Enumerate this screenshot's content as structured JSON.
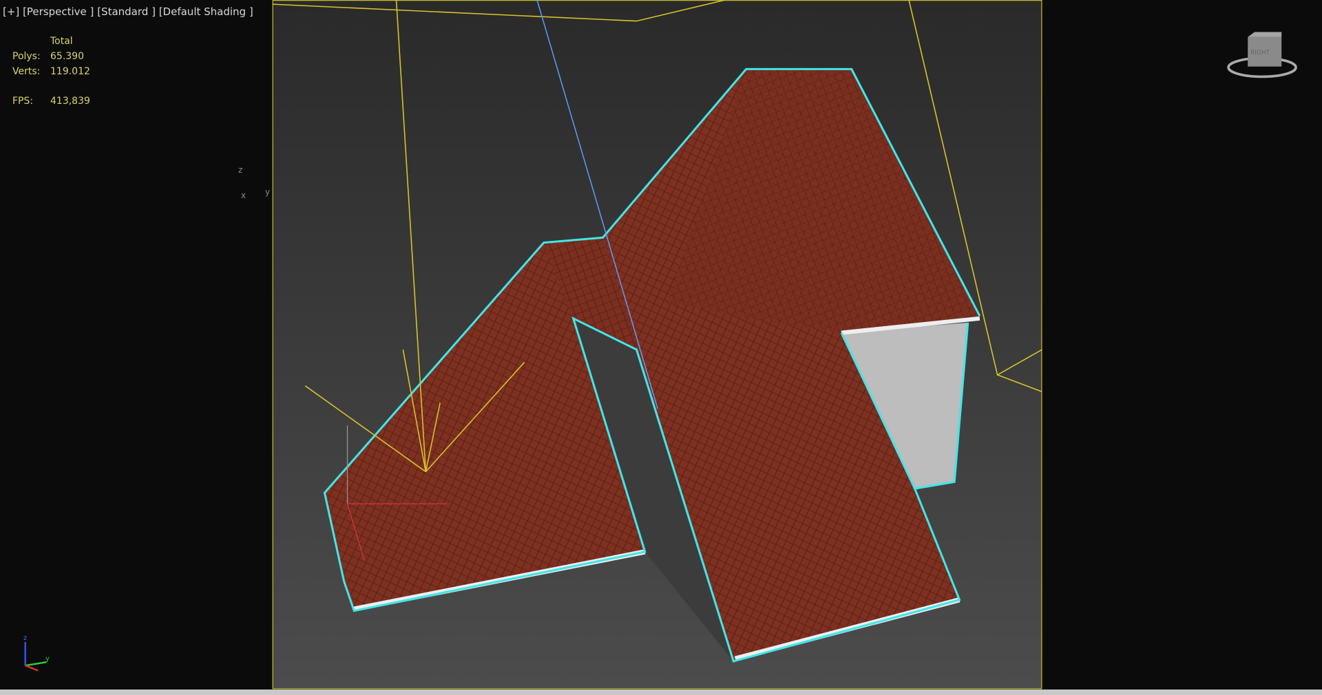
{
  "viewport": {
    "labels": {
      "plus": "[+]",
      "view": "[Perspective ]",
      "mode": "[Standard ]",
      "shading": "[Default Shading ]"
    },
    "stats": {
      "header": "Total",
      "polys_label": "Polys:",
      "polys_value": "65.390",
      "verts_label": "Verts:",
      "verts_value": "119.012",
      "fps_label": "FPS:",
      "fps_value": "413,839"
    },
    "gizmo_labels": {
      "z": "z",
      "x": "x",
      "y": "y"
    },
    "corner_axis": {
      "z": "z",
      "y": "y"
    },
    "viewcube_label": "RIGHT"
  },
  "colors": {
    "selection": "#3fe6ea",
    "frame": "#c9b92a",
    "roof": "#7a2e1e",
    "wall": "#b9b9b9"
  }
}
